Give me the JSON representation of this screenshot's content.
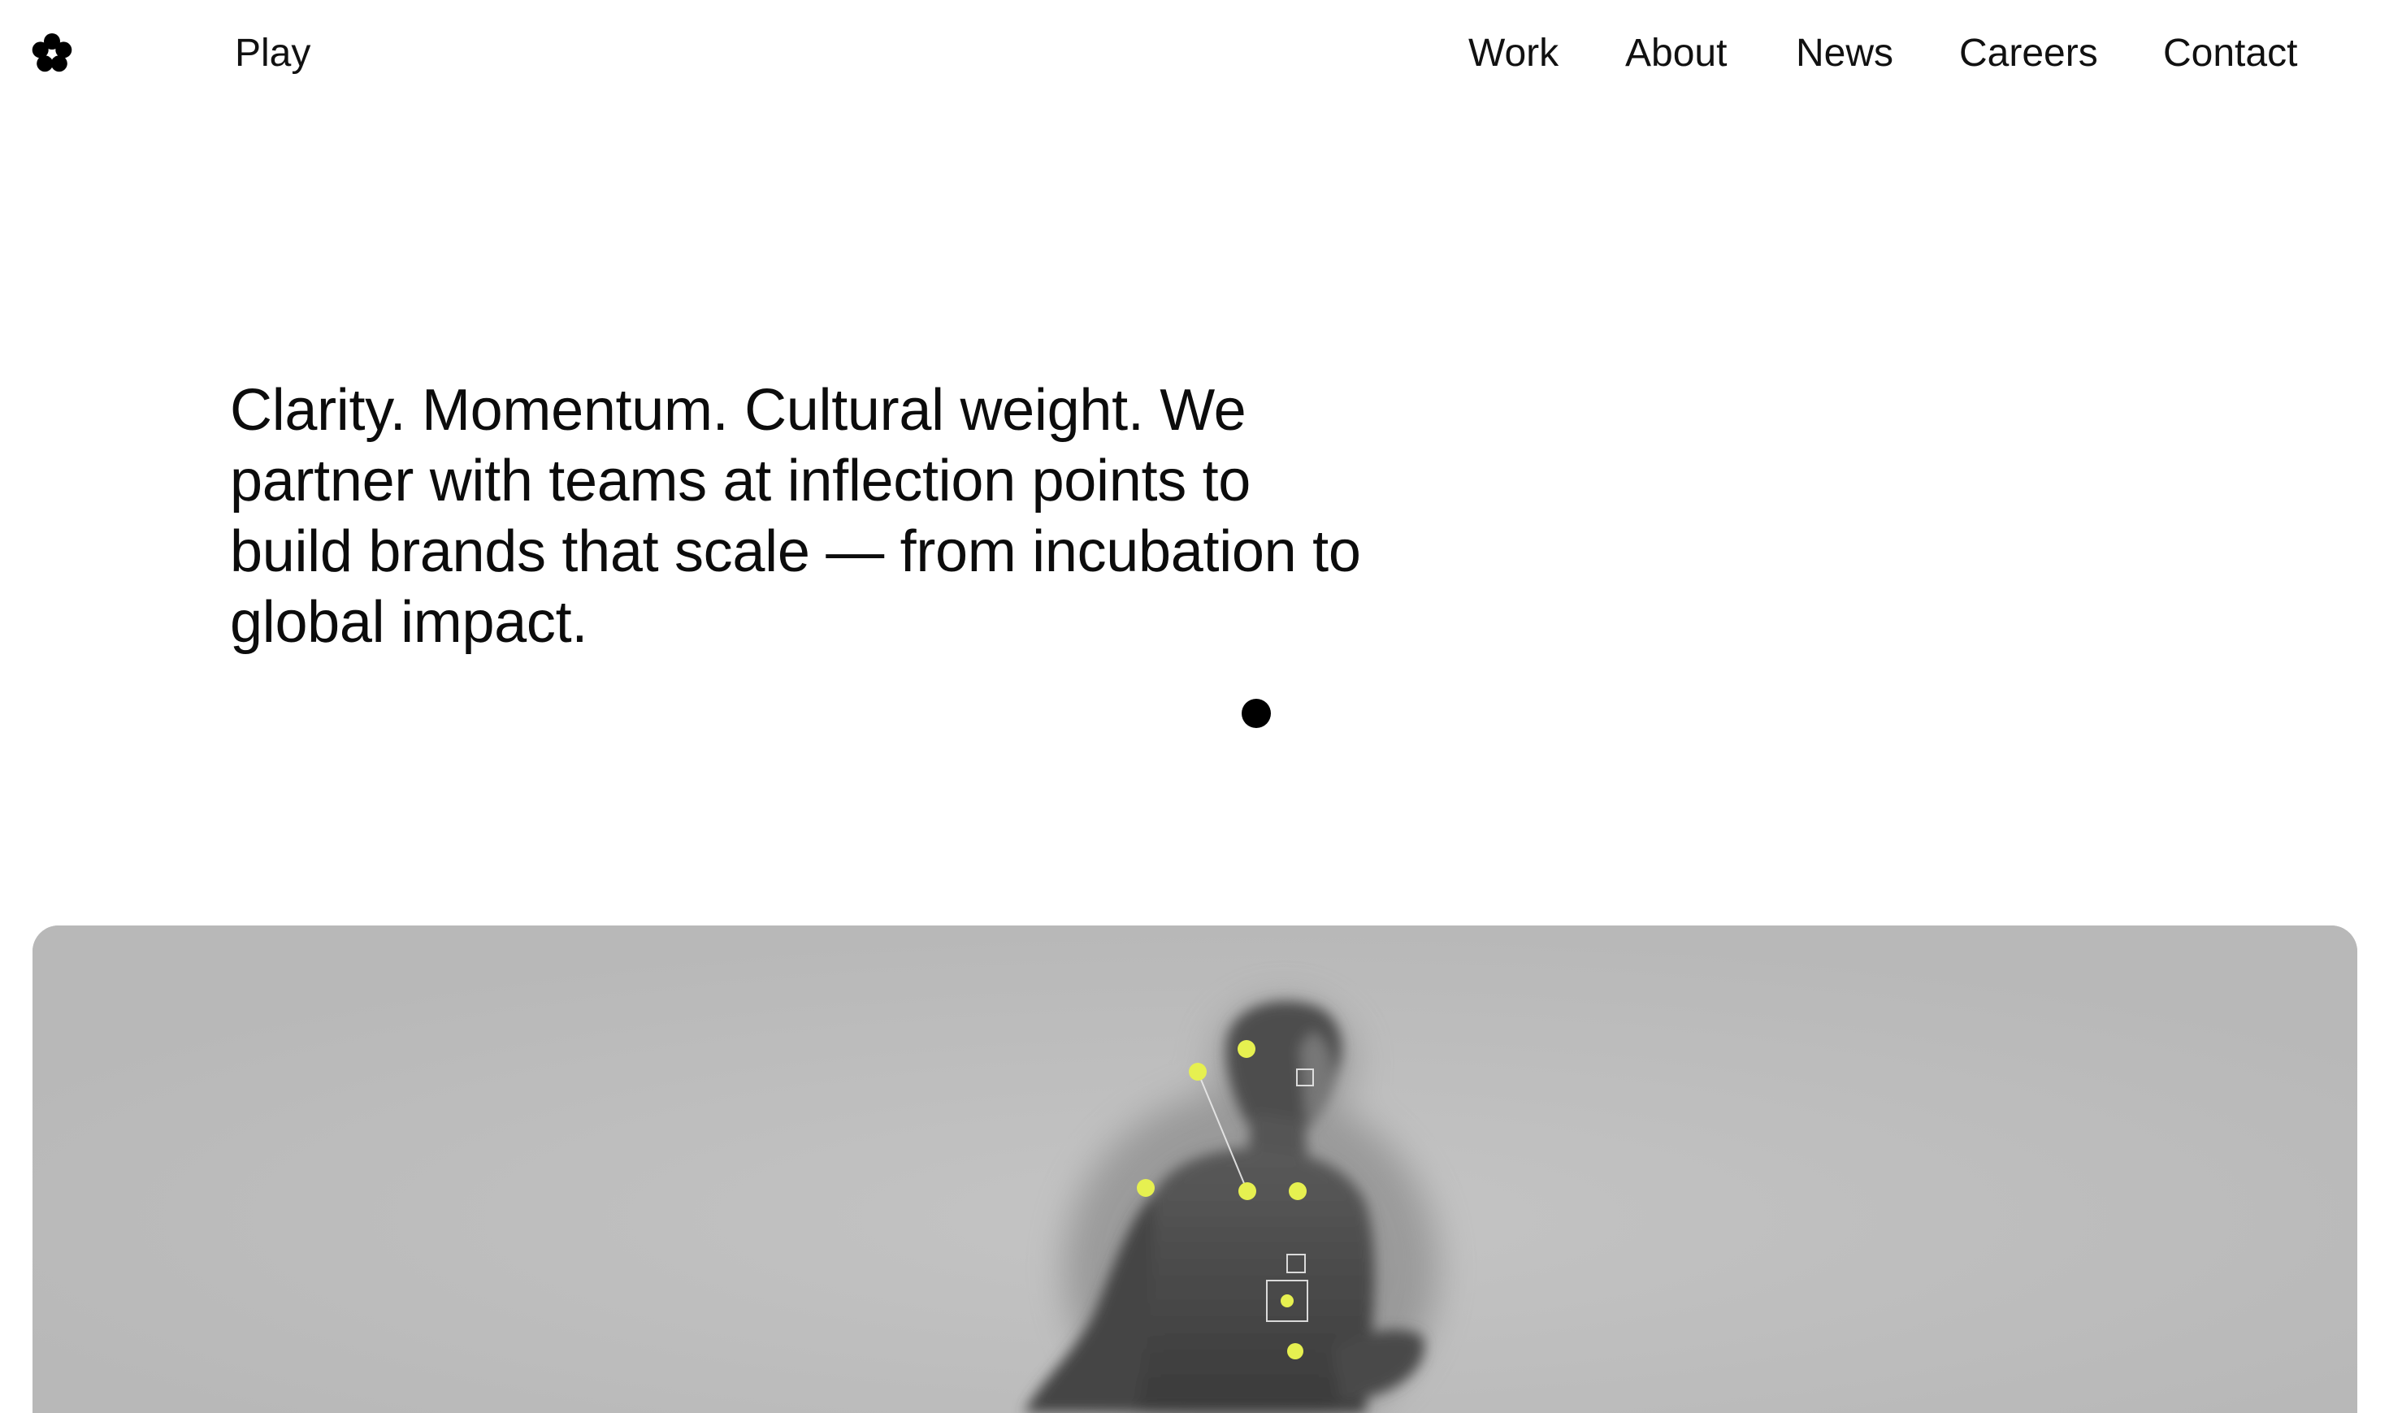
{
  "header": {
    "logo_icon": "flower-icon",
    "brand_link": "Play",
    "nav": [
      "Work",
      "About",
      "News",
      "Careers",
      "Contact"
    ]
  },
  "intro": {
    "text": "Clarity. Momentum. Cultural weight. We partner with teams at inflection points to build brands that scale — from incubation to global impact."
  },
  "hero": {
    "image": "grayscale-man-motion-tracking-photo",
    "accent_color": "#e6f050",
    "background_color": "#bbbbbb"
  }
}
